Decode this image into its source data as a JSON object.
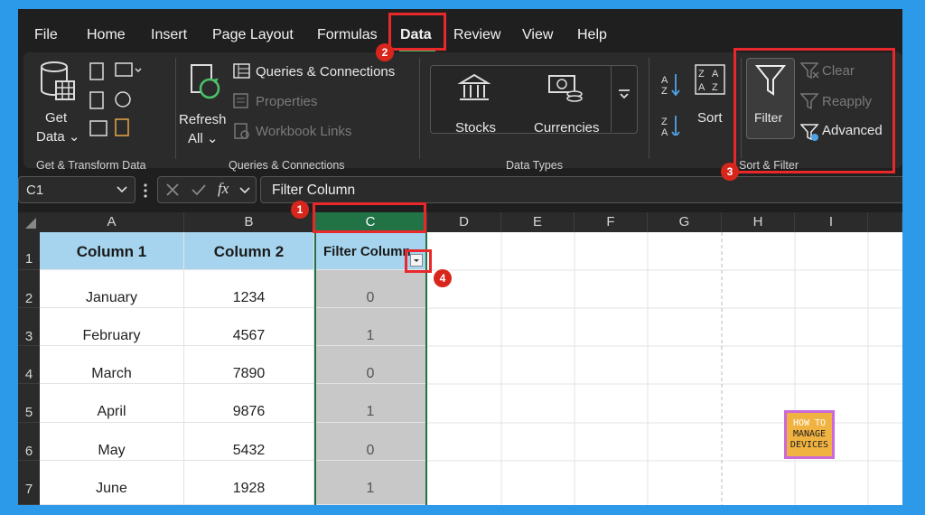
{
  "menu": {
    "items": [
      "File",
      "Home",
      "Insert",
      "Page Layout",
      "Formulas",
      "Data",
      "Review",
      "View",
      "Help"
    ]
  },
  "ribbon": {
    "get_data": {
      "line1": "Get",
      "line2": "Data ⌄"
    },
    "get_transform_label": "Get & Transform Data",
    "refresh": {
      "line1": "Refresh",
      "line2": "All ⌄"
    },
    "queries_connections": "Queries & Connections",
    "properties": "Properties",
    "workbook_links": "Workbook Links",
    "queries_group_label": "Queries & Connections",
    "stocks": "Stocks",
    "currencies": "Currencies",
    "data_types_label": "Data Types",
    "sort": "Sort",
    "filter": "Filter",
    "clear": "Clear",
    "reapply": "Reapply",
    "advanced": "Advanced",
    "sort_filter_label": "Sort & Filter"
  },
  "formula_bar": {
    "name_box": "C1",
    "fx": "fx",
    "formula": "Filter Column"
  },
  "columns": [
    "A",
    "B",
    "C",
    "D",
    "E",
    "F",
    "G",
    "H",
    "I"
  ],
  "rows": [
    "1",
    "2",
    "3",
    "4",
    "5",
    "6",
    "7"
  ],
  "table": {
    "headers": [
      "Column 1",
      "Column 2",
      "Filter Column"
    ],
    "data": [
      [
        "January",
        "1234",
        "0"
      ],
      [
        "February",
        "4567",
        "1"
      ],
      [
        "March",
        "7890",
        "0"
      ],
      [
        "April",
        "9876",
        "1"
      ],
      [
        "May",
        "5432",
        "0"
      ],
      [
        "June",
        "1928",
        "1"
      ]
    ]
  },
  "badges": [
    "1",
    "2",
    "3",
    "4"
  ],
  "logo": {
    "line1": "HOW TO",
    "line2": "MANAGE",
    "line3": "DEVICES"
  },
  "colors": {
    "accent_red": "#e8282a",
    "badge_red": "#d9261c",
    "header_fill": "#a6d4ee",
    "selected_col": "#c8c8c8",
    "selection_green": "#217346",
    "background_blue": "#2d9ae9"
  }
}
